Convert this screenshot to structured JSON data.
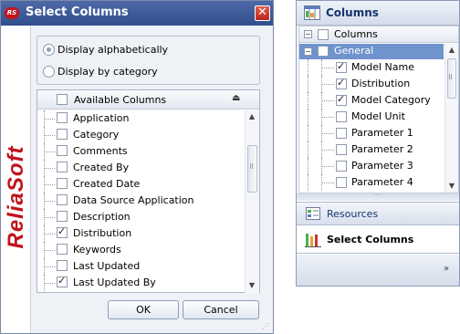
{
  "dialog": {
    "title": "Select Columns",
    "logo_text": "RS",
    "close_label": "✕",
    "brand": "ReliaSoft",
    "radio_alphabetical": "Display alphabetically",
    "radio_category": "Display by category",
    "alphabetical_selected": true,
    "list_header": "Available Columns",
    "items": [
      {
        "label": "Application",
        "checked": false
      },
      {
        "label": "Category",
        "checked": false
      },
      {
        "label": "Comments",
        "checked": false
      },
      {
        "label": "Created By",
        "checked": false
      },
      {
        "label": "Created Date",
        "checked": false
      },
      {
        "label": "Data Source Application",
        "checked": false
      },
      {
        "label": "Description",
        "checked": false
      },
      {
        "label": "Distribution",
        "checked": true
      },
      {
        "label": "Keywords",
        "checked": false
      },
      {
        "label": "Last Updated",
        "checked": false
      },
      {
        "label": "Last Updated By",
        "checked": true
      }
    ],
    "ok_label": "OK",
    "cancel_label": "Cancel"
  },
  "panel": {
    "title": "Columns",
    "tree_header": "Columns",
    "group": "General",
    "items": [
      {
        "label": "Model Name",
        "checked": true
      },
      {
        "label": "Distribution",
        "checked": true
      },
      {
        "label": "Model Category",
        "checked": true
      },
      {
        "label": "Model Unit",
        "checked": false
      },
      {
        "label": "Parameter 1",
        "checked": false
      },
      {
        "label": "Parameter 2",
        "checked": false
      },
      {
        "label": "Parameter 3",
        "checked": false
      },
      {
        "label": "Parameter 4",
        "checked": false
      }
    ],
    "resources_label": "Resources",
    "select_columns_label": "Select Columns"
  }
}
